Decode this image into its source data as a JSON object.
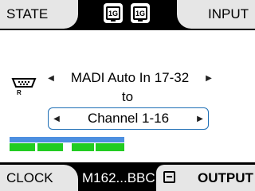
{
  "header": {
    "left_tab": "STATE",
    "right_tab": "INPUT",
    "badges": [
      {
        "text": "1G",
        "icon": "network-1g-icon"
      },
      {
        "text": "1G",
        "icon": "network-1g-icon"
      }
    ]
  },
  "routing": {
    "source": "MADI Auto In 17-32",
    "connector": "to",
    "destination": "Channel 1-16",
    "port_icon_label": "R"
  },
  "meters": {
    "top_color": "#4d8fe0",
    "level_color": "#22cc22",
    "segments_lit": [
      true,
      true,
      false,
      true,
      true
    ]
  },
  "footer": {
    "left_tab": "CLOCK",
    "device": "M162...BBC",
    "right_tab": "OUTPUT"
  }
}
